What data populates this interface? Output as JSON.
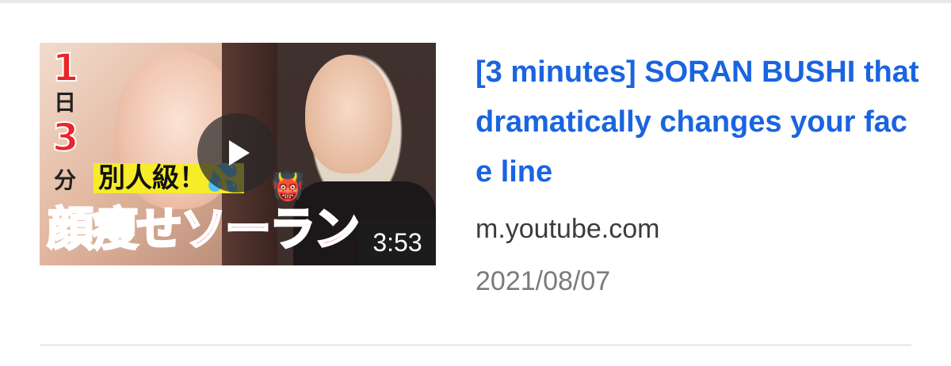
{
  "result": {
    "title": "[3 minutes] SORAN BUSHI that dramatically changes your face line",
    "source": "m.youtube.com",
    "date": "2021/08/07",
    "thumbnail": {
      "duration": "3:53",
      "overlay_texts": {
        "num_one": "1",
        "unit_day": "日",
        "num_three": "3",
        "unit_minute": "分",
        "catchphrase": "別人級！💦",
        "headline": "顔痩せソーラン",
        "emoji": "👹"
      }
    }
  },
  "colors": {
    "title_link": "#1a64e0",
    "source_text": "#3c3c3c",
    "date_text": "#7b7b7b",
    "divider": "#ededed"
  },
  "icons": {
    "play": "play-icon"
  }
}
